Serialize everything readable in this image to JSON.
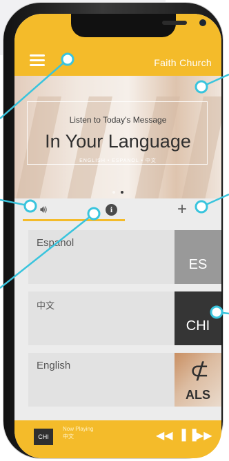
{
  "header": {
    "church_name": "Faith Church"
  },
  "hero": {
    "subtitle": "Listen to Today's Message",
    "title": "In Your Language",
    "languages_line": "ENGLISH  •  ESPANOL  •  中文"
  },
  "tabs": {
    "speaker_icon": "speaker-icon",
    "info_icon": "info-icon",
    "info_glyph": "i",
    "add_icon": "plus-icon",
    "add_glyph": "+"
  },
  "languages": [
    {
      "name": "Espanol",
      "code": "ES"
    },
    {
      "name": "中文",
      "code": "CHI"
    },
    {
      "name": "English",
      "code": "ALS"
    }
  ],
  "player": {
    "thumb": "CHI",
    "now_playing_label": "Now Playing",
    "now_playing_lang": "中文",
    "controls": {
      "rewind": "◀◀",
      "pause": "❚❚",
      "forward": "▶▶"
    }
  },
  "colors": {
    "accent": "#f4bb2a",
    "callout": "#39c4dd"
  }
}
